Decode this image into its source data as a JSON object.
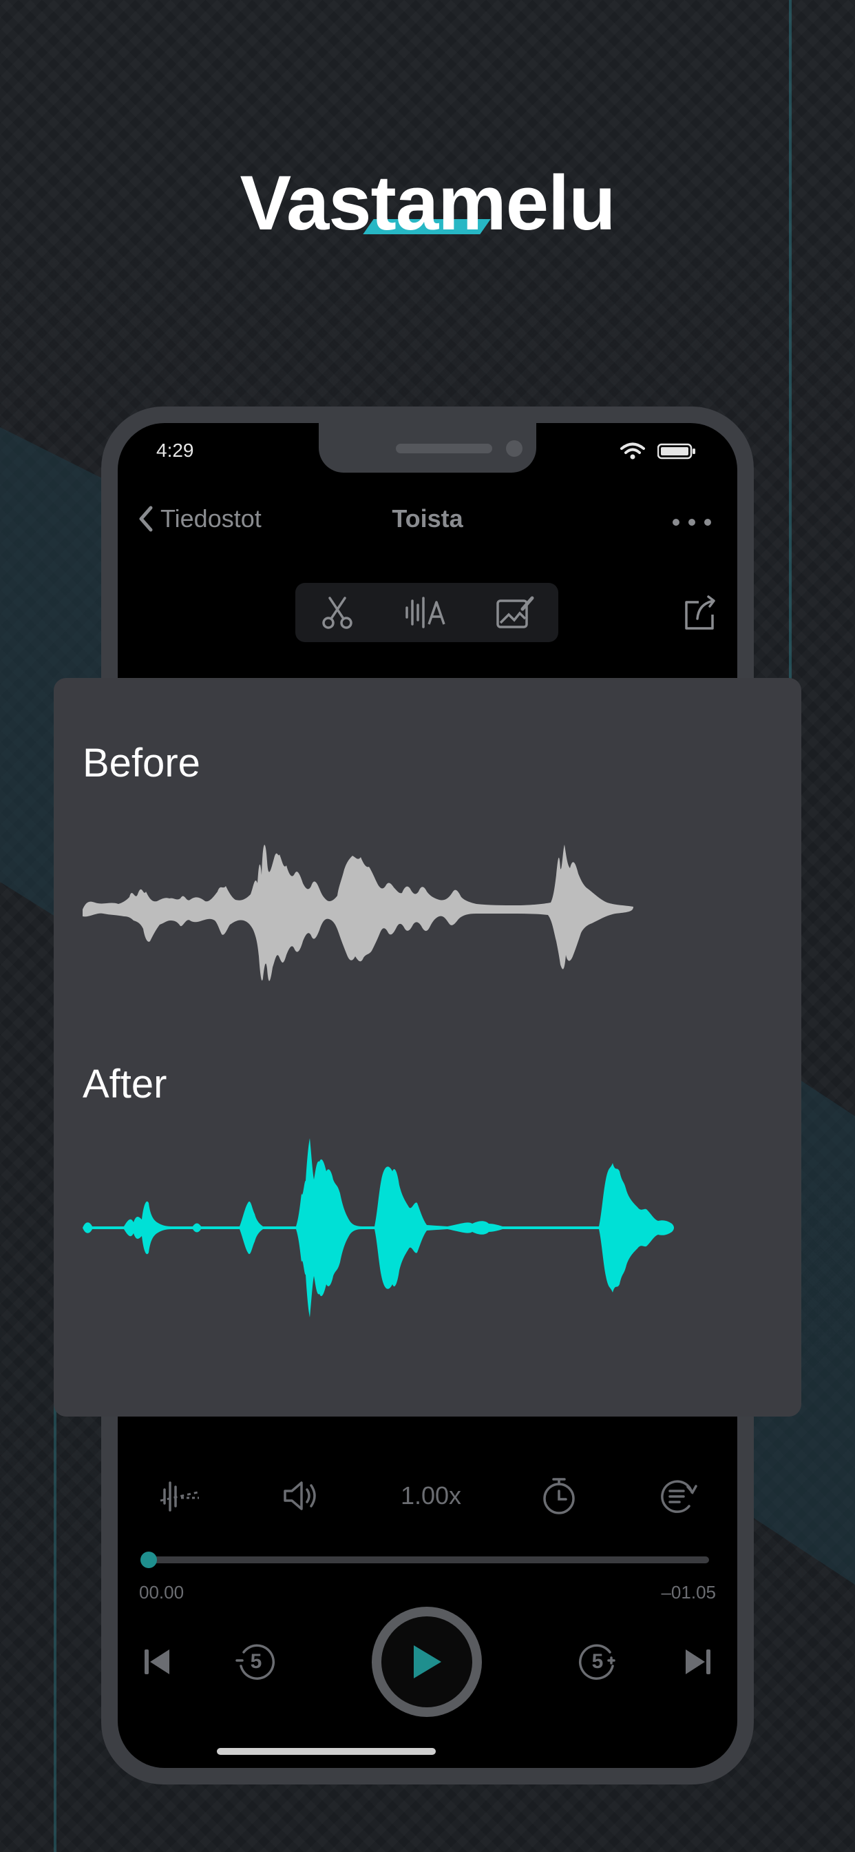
{
  "headline": "Vastamelu",
  "status_bar": {
    "time": "4:29"
  },
  "nav": {
    "back_label": "Tiedostot",
    "title": "Toista"
  },
  "toolbar": {
    "icons": [
      "scissors-icon",
      "waveform-text-icon",
      "edit-image-icon"
    ],
    "share_icon": "share-icon"
  },
  "comparison": {
    "before_label": "Before",
    "after_label": "After",
    "before_color": "#bdbdbd",
    "after_color": "#00e0d6"
  },
  "player": {
    "speed": "1.00x",
    "elapsed": "00.00",
    "remaining": "–01.05",
    "skip_back_seconds": "5",
    "skip_forward_seconds": "5",
    "progress": 0.0,
    "accent_color": "#1f8f8e"
  }
}
